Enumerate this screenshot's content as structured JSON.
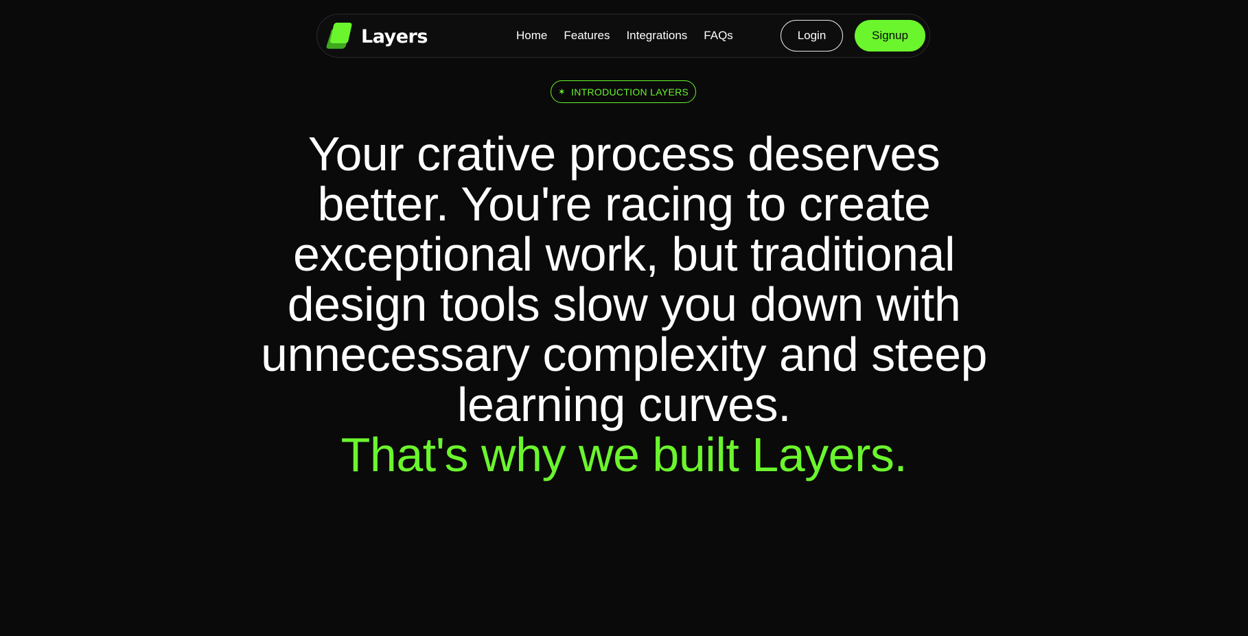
{
  "nav": {
    "brand": "Layers",
    "links": [
      "Home",
      "Features",
      "Integrations",
      "FAQs"
    ],
    "login_label": "Login",
    "signup_label": "Signup"
  },
  "badge": {
    "icon": "sparkle-icon",
    "text": "INTRODUCTION LAYERS"
  },
  "hero": {
    "headline": "Your crative process deserves better. You're racing to create exceptional work, but traditional design tools slow you down with unnecessary complexity and steep learning curves.",
    "accent": "That's why we built Layers."
  },
  "colors": {
    "background": "#0a0a0a",
    "accent": "#6bf52d",
    "text": "#ffffff"
  }
}
